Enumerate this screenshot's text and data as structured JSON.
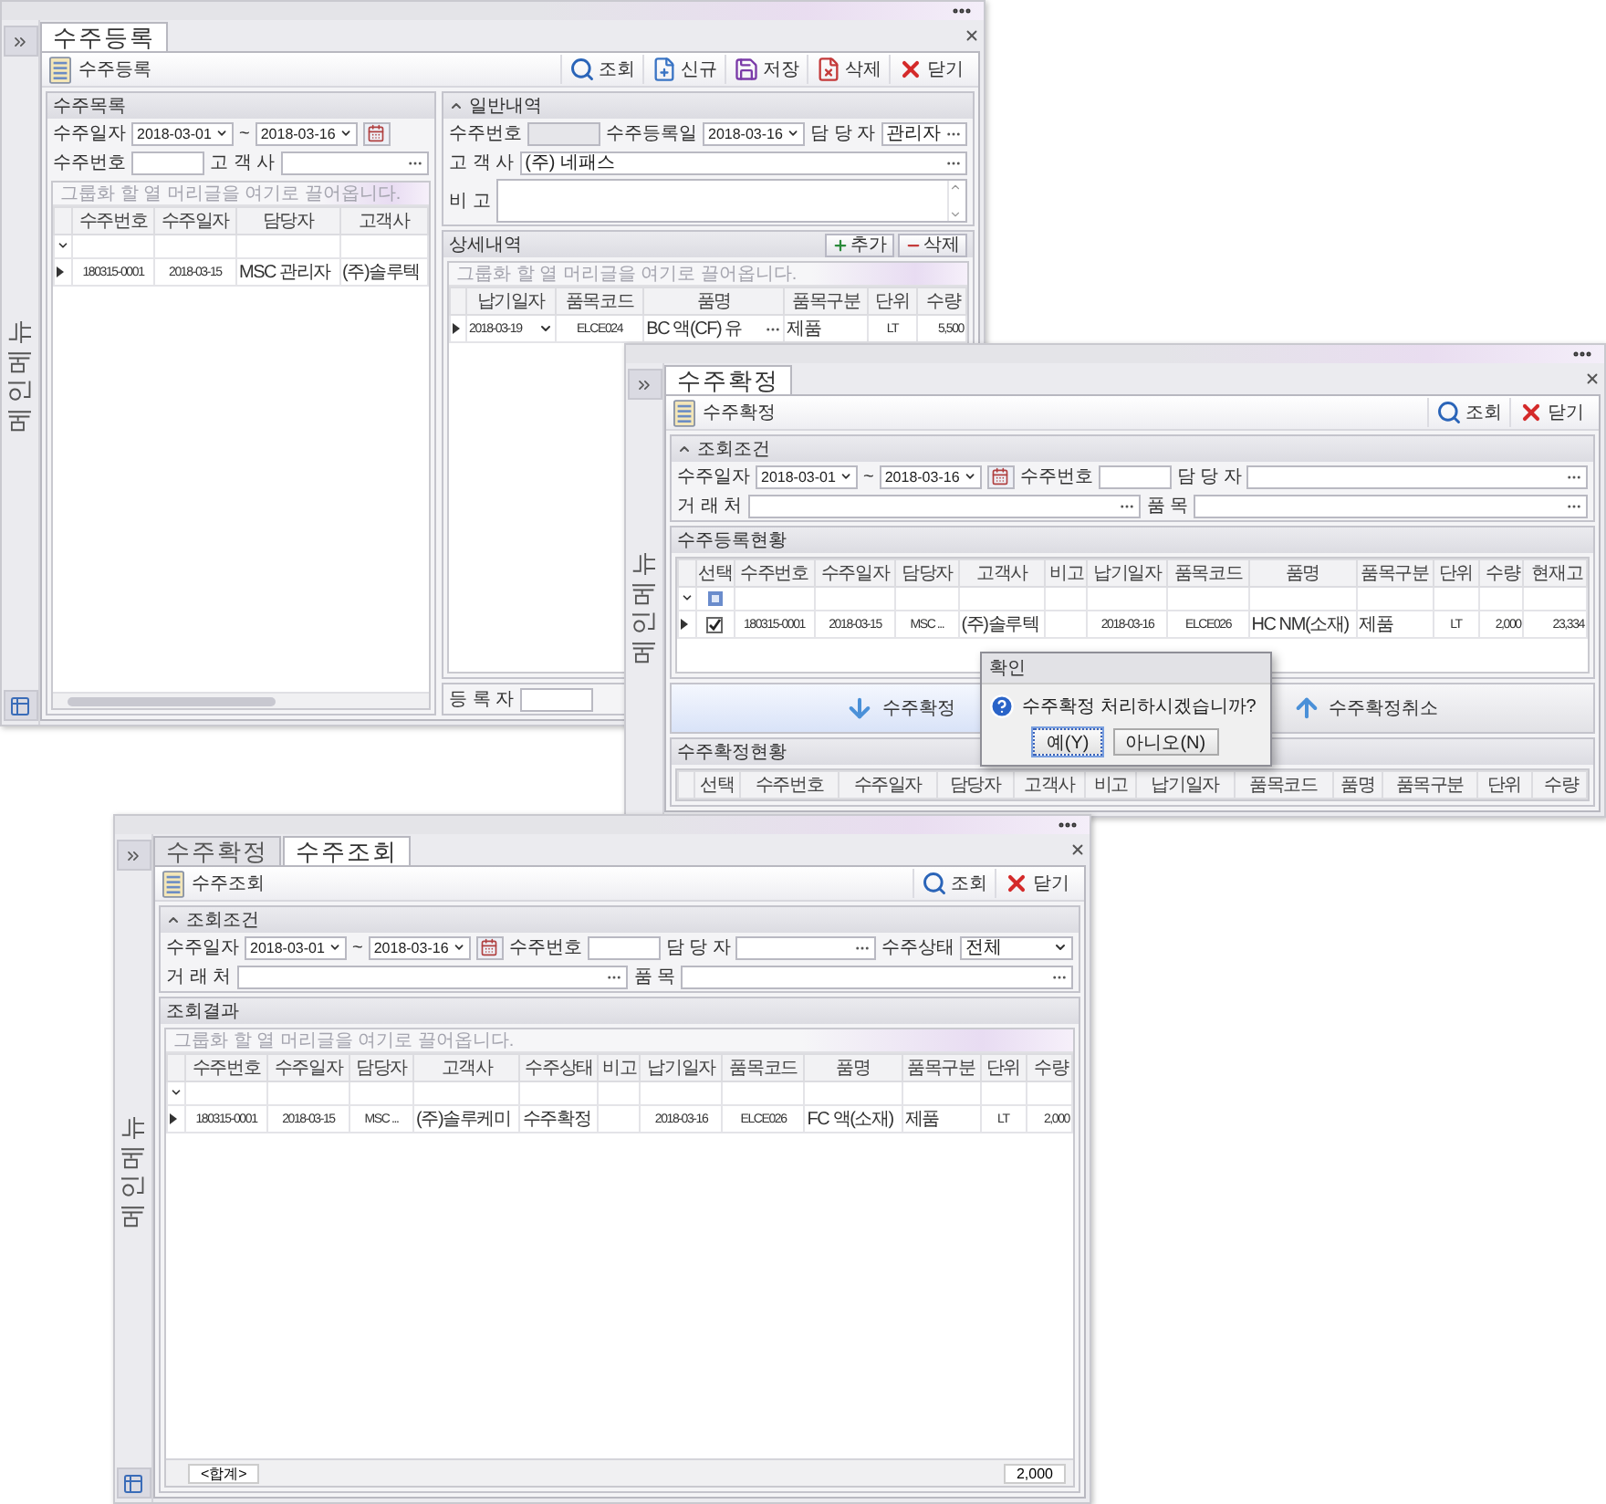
{
  "windows": [
    {
      "side": {
        "label": "메인메뉴",
        "calendar_button": true
      },
      "tabs": [
        {
          "label": "수주등록",
          "selected": true
        }
      ],
      "toolbar": {
        "title": "수주등록",
        "buttons": [
          {
            "label": "조회",
            "kind": "search"
          },
          {
            "label": "신규",
            "kind": "new"
          },
          {
            "label": "저장",
            "kind": "save"
          },
          {
            "label": "삭제",
            "kind": "delete"
          },
          {
            "label": "닫기",
            "kind": "close"
          }
        ]
      },
      "columns": [
        [
          {
            "title": "수주목록",
            "rows": [
              [
                {
                  "kind": "label",
                  "text": "수주일자"
                },
                {
                  "kind": "date",
                  "value": "2018-03-01"
                },
                {
                  "kind": "tilde",
                  "text": "~"
                },
                {
                  "kind": "date",
                  "value": "2018-03-16"
                },
                {
                  "kind": "calendar"
                }
              ],
              [
                {
                  "kind": "label",
                  "text": "수주번호"
                },
                {
                  "kind": "input"
                },
                {
                  "kind": "label",
                  "text": "고 객 사"
                },
                {
                  "kind": "lookup"
                }
              ]
            ],
            "grid": {
              "group_hint": "그룹화 할 열 머리글을 여기로 끌어옵니다.",
              "filter_row": true,
              "hscroll": true,
              "columns": [
                {
                  "label": "수주번호",
                  "kind": "code"
                },
                {
                  "label": "수주일자",
                  "kind": "code"
                },
                {
                  "label": "담당자",
                  "kind": "text"
                },
                {
                  "label": "고객사",
                  "kind": "text"
                }
              ],
              "rows": [
                {
                  "cells": [
                    "180315-0001",
                    "2018-03-15",
                    "MSC 관리자",
                    "(주)솔루텍"
                  ]
                }
              ]
            }
          }
        ],
        [
          {
            "title": "일반내역",
            "collapsible": true,
            "rows": [
              [
                {
                  "kind": "label",
                  "text": "수주번호"
                },
                {
                  "kind": "input",
                  "disabled": true
                },
                {
                  "kind": "label",
                  "text": "수주등록일"
                },
                {
                  "kind": "date",
                  "value": "2018-03-16"
                },
                {
                  "kind": "label",
                  "text": "담 당 자"
                },
                {
                  "kind": "lookup",
                  "value": "관리자"
                }
              ],
              [
                {
                  "kind": "label",
                  "text": "고 객 사"
                },
                {
                  "kind": "lookup",
                  "value": "(주) 네패스"
                }
              ],
              [
                {
                  "kind": "label",
                  "text": "비 고"
                },
                {
                  "kind": "memo"
                }
              ]
            ]
          },
          {
            "title": "상세내역",
            "buttons": [
              {
                "label": "추가",
                "kind": "add"
              },
              {
                "label": "삭제",
                "kind": "remove"
              }
            ],
            "grid": {
              "group_hint": "그룹화 할 열 머리글을 여기로 끌어옵니다.",
              "columns": [
                {
                  "label": "납기일자",
                  "kind": "combo"
                },
                {
                  "label": "품목코드",
                  "kind": "code"
                },
                {
                  "label": "품명",
                  "kind": "lookup"
                },
                {
                  "label": "품목구분",
                  "kind": "text"
                },
                {
                  "label": "단위",
                  "kind": "code"
                },
                {
                  "label": "수량",
                  "kind": "num"
                }
              ],
              "rows": [
                {
                  "cells": [
                    "2018-03-19",
                    "ELCE024",
                    "BC 액(CF) 유",
                    "제품",
                    "LT",
                    "5,500"
                  ]
                }
              ]
            }
          },
          {
            "rows": [
              [
                {
                  "kind": "label",
                  "text": "등 록 자"
                },
                {
                  "kind": "input"
                }
              ]
            ]
          }
        ]
      ]
    },
    {
      "side": {
        "label": "메인메뉴"
      },
      "tabs": [
        {
          "label": "수주확정",
          "selected": true
        }
      ],
      "toolbar": {
        "title": "수주확정",
        "buttons": [
          {
            "label": "조회",
            "kind": "search"
          },
          {
            "label": "닫기",
            "kind": "close"
          }
        ]
      },
      "columns": [
        [
          {
            "title": "조회조건",
            "collapsible": true,
            "rows": [
              [
                {
                  "kind": "label",
                  "text": "수주일자"
                },
                {
                  "kind": "date",
                  "value": "2018-03-01"
                },
                {
                  "kind": "tilde",
                  "text": "~"
                },
                {
                  "kind": "date",
                  "value": "2018-03-16"
                },
                {
                  "kind": "calendar"
                },
                {
                  "kind": "label",
                  "text": "수주번호"
                },
                {
                  "kind": "input"
                },
                {
                  "kind": "label",
                  "text": "담 당 자"
                },
                {
                  "kind": "lookup"
                }
              ],
              [
                {
                  "kind": "label",
                  "text": "거 래 처"
                },
                {
                  "kind": "lookup"
                },
                {
                  "kind": "label",
                  "text": "품 목"
                },
                {
                  "kind": "lookup"
                }
              ]
            ]
          },
          {
            "title": "수주등록현황",
            "grid": {
              "filter_row": true,
              "columns": [
                {
                  "label": "선택",
                  "kind": "check"
                },
                {
                  "label": "수주번호",
                  "kind": "code"
                },
                {
                  "label": "수주일자",
                  "kind": "code"
                },
                {
                  "label": "담당자",
                  "kind": "code"
                },
                {
                  "label": "고객사",
                  "kind": "text"
                },
                {
                  "label": "비고",
                  "kind": "text"
                },
                {
                  "label": "납기일자",
                  "kind": "code"
                },
                {
                  "label": "품목코드",
                  "kind": "code"
                },
                {
                  "label": "품명",
                  "kind": "text"
                },
                {
                  "label": "품목구분",
                  "kind": "text"
                },
                {
                  "label": "단위",
                  "kind": "code"
                },
                {
                  "label": "수량",
                  "kind": "num"
                },
                {
                  "label": "현재고",
                  "kind": "num"
                }
              ],
              "rows": [
                {
                  "checked": true,
                  "cells": [
                    "",
                    "180315-0001",
                    "2018-03-15",
                    "MSC ...",
                    "(주)솔루텍",
                    "",
                    "2018-03-16",
                    "ELCE026",
                    "HC NM(소재)",
                    "제품",
                    "LT",
                    "2,000",
                    "23,334"
                  ]
                }
              ]
            }
          },
          {
            "actions": [
              {
                "label": "수주확정",
                "kind": "down",
                "selected": true
              },
              {
                "label": "수주확정취소",
                "kind": "up",
                "selected": false
              }
            ]
          },
          {
            "title": "수주확정현황",
            "grid": {
              "columns": [
                {
                  "label": "선택",
                  "kind": "check"
                },
                {
                  "label": "수주번호",
                  "kind": "code"
                },
                {
                  "label": "수주일자",
                  "kind": "code"
                },
                {
                  "label": "담당자",
                  "kind": "code"
                },
                {
                  "label": "고객사",
                  "kind": "text"
                },
                {
                  "label": "비고",
                  "kind": "text"
                },
                {
                  "label": "납기일자",
                  "kind": "code"
                },
                {
                  "label": "품목코드",
                  "kind": "code"
                },
                {
                  "label": "품명",
                  "kind": "text"
                },
                {
                  "label": "품목구분",
                  "kind": "text"
                },
                {
                  "label": "단위",
                  "kind": "code"
                },
                {
                  "label": "수량",
                  "kind": "num"
                }
              ]
            }
          }
        ]
      ],
      "dialog": {
        "title": "확인",
        "message": "수주확정 처리하시겠습니까?",
        "buttons": [
          {
            "label": "예(Y)",
            "selected": true
          },
          {
            "label": "아니오(N)",
            "selected": false
          }
        ]
      }
    },
    {
      "side": {
        "label": "메인메뉴",
        "calendar_button": true
      },
      "tabs": [
        {
          "label": "수주확정",
          "selected": false
        },
        {
          "label": "수주조회",
          "selected": true
        }
      ],
      "toolbar": {
        "title": "수주조회",
        "buttons": [
          {
            "label": "조회",
            "kind": "search"
          },
          {
            "label": "닫기",
            "kind": "close"
          }
        ]
      },
      "columns": [
        [
          {
            "title": "조회조건",
            "collapsible": true,
            "rows": [
              [
                {
                  "kind": "label",
                  "text": "수주일자"
                },
                {
                  "kind": "date",
                  "value": "2018-03-01"
                },
                {
                  "kind": "tilde",
                  "text": "~"
                },
                {
                  "kind": "date",
                  "value": "2018-03-16"
                },
                {
                  "kind": "calendar"
                },
                {
                  "kind": "label",
                  "text": "수주번호"
                },
                {
                  "kind": "input"
                },
                {
                  "kind": "label",
                  "text": "담 당 자"
                },
                {
                  "kind": "lookup"
                },
                {
                  "kind": "label",
                  "text": "수주상태"
                },
                {
                  "kind": "combo",
                  "value": "전체"
                }
              ],
              [
                {
                  "kind": "label",
                  "text": "거 래 처"
                },
                {
                  "kind": "lookup"
                },
                {
                  "kind": "label",
                  "text": "품 목"
                },
                {
                  "kind": "lookup"
                }
              ]
            ]
          },
          {
            "title": "조회결과",
            "grid": {
              "group_hint": "그룹화 할 열 머리글을 여기로 끌어옵니다.",
              "filter_row": true,
              "columns": [
                {
                  "label": "수주번호",
                  "kind": "code"
                },
                {
                  "label": "수주일자",
                  "kind": "code"
                },
                {
                  "label": "담당자",
                  "kind": "code"
                },
                {
                  "label": "고객사",
                  "kind": "text"
                },
                {
                  "label": "수주상태",
                  "kind": "text"
                },
                {
                  "label": "비고",
                  "kind": "text"
                },
                {
                  "label": "납기일자",
                  "kind": "code"
                },
                {
                  "label": "품목코드",
                  "kind": "code"
                },
                {
                  "label": "품명",
                  "kind": "text"
                },
                {
                  "label": "품목구분",
                  "kind": "text"
                },
                {
                  "label": "단위",
                  "kind": "code"
                },
                {
                  "label": "수량",
                  "kind": "num"
                }
              ],
              "rows": [
                {
                  "cells": [
                    "180315-0001",
                    "2018-03-15",
                    "MSC ...",
                    "(주)솔루케미",
                    "수주확정",
                    "",
                    "2018-03-16",
                    "ELCE026",
                    "FC 액(소재)",
                    "제품",
                    "LT",
                    "2,000"
                  ]
                }
              ],
              "footer": {
                "label": "<합계>",
                "total": "2,000"
              }
            }
          }
        ]
      ]
    }
  ]
}
